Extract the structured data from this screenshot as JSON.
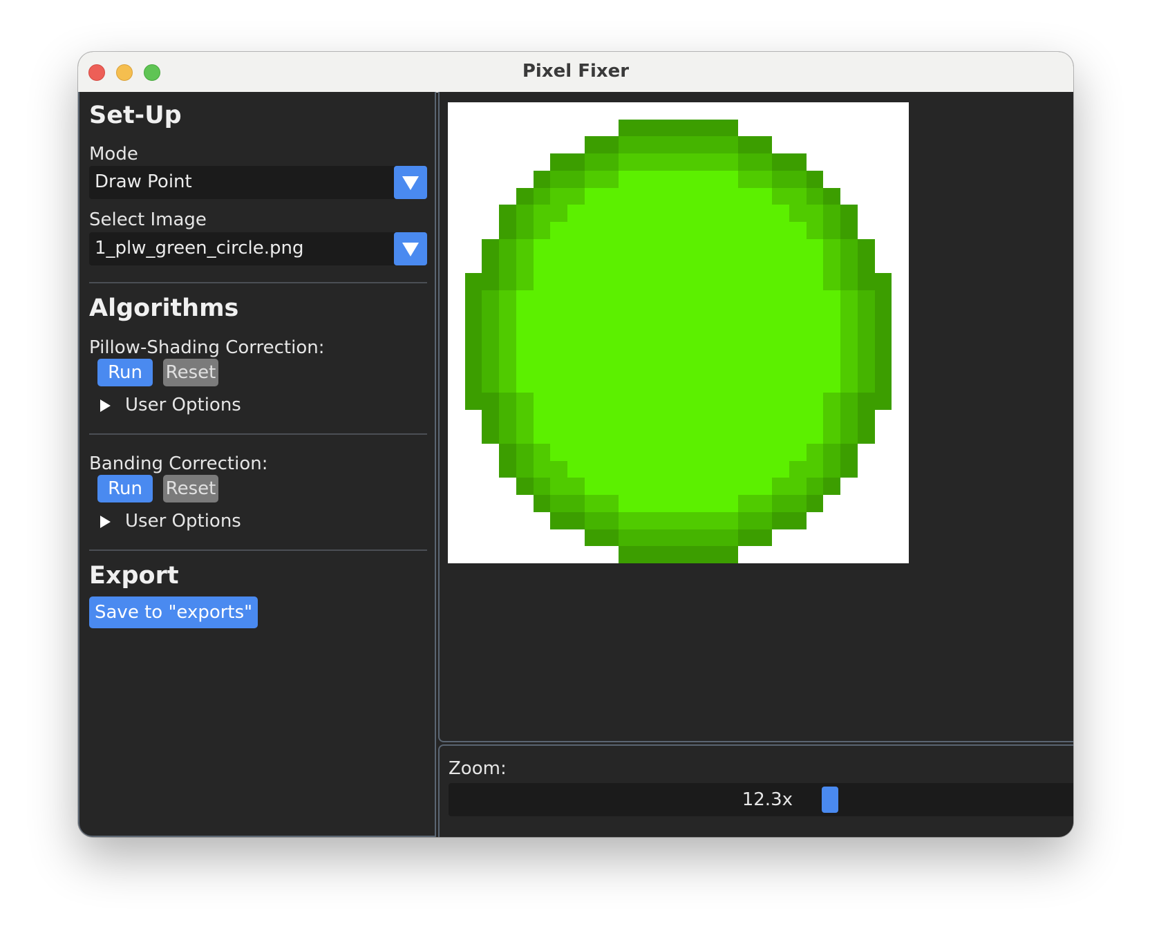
{
  "window": {
    "title": "Pixel Fixer"
  },
  "setup": {
    "heading": "Set-Up",
    "mode_label": "Mode",
    "mode_value": "Draw Point",
    "image_label": "Select Image",
    "image_value": "1_plw_green_circle.png"
  },
  "algorithms": {
    "heading": "Algorithms",
    "pillow": {
      "label": "Pillow-Shading Correction:",
      "run_label": "Run",
      "reset_label": "Reset",
      "options_label": "User Options"
    },
    "banding": {
      "label": "Banding Correction:",
      "run_label": "Run",
      "reset_label": "Reset",
      "options_label": "User Options"
    }
  },
  "export": {
    "heading": "Export",
    "save_label": "Save to \"exports\""
  },
  "zoom": {
    "label": "Zoom:",
    "value": "12.3x",
    "level": 0.6
  },
  "colors": {
    "accent": "#4a8af0",
    "panel_bg": "#262626",
    "field_bg": "#1b1b1b",
    "panel_border": "#5a6572",
    "reset_button": "#7b7b7b",
    "image_palette": [
      "#ffffff",
      "#3c9e00",
      "#45b400",
      "#50cb00",
      "#5cf000"
    ]
  },
  "image_pixels": [
    "000000000000000000000000000",
    "000000000011111110000000000",
    "000000001122222221100000000",
    "000000112233333332211000000",
    "000001223344444443322100000",
    "000012334444444444433210000",
    "000123344444444444443321000",
    "000123444444444444444321000",
    "001234444444444444444432100",
    "001234444444444444444432100",
    "011234444444444444444432110",
    "012344444444444444444443210",
    "012344444444444444444443210",
    "012344444444444444444443210",
    "012344444444444444444443210",
    "012344444444444444444443210",
    "012344444444444444444443210",
    "011234444444444444444432110",
    "001234444444444444444432100",
    "001234444444444444444432100",
    "000123444444444444444321000",
    "000123344444444444443321000",
    "000012334444444444433210000",
    "000001223344444443322100000",
    "000000112233333332211000000",
    "000000001122222221100000000",
    "000000000011111110000000000"
  ]
}
